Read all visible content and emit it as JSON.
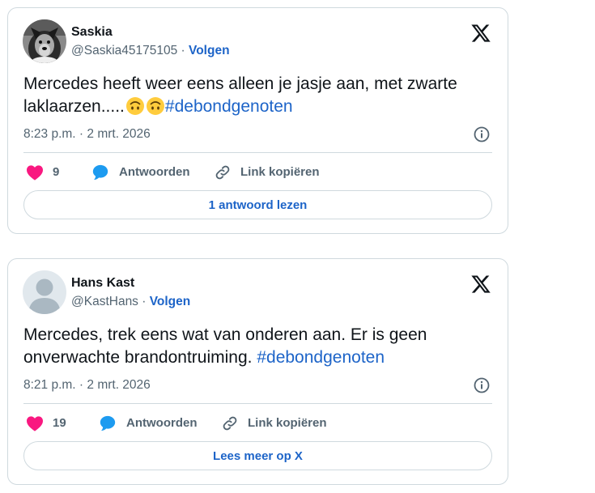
{
  "tweets": [
    {
      "author": "Saskia",
      "handle": "@Saskia45175105",
      "separator": "·",
      "follow_label": "Volgen",
      "text": "Mercedes heeft weer eens alleen je jasje aan, met zwarte laklaarzen.....",
      "emojis": [
        "upside-down-face-emoji",
        "upside-down-face-emoji"
      ],
      "hashtag": "#debondgenoten",
      "timestamp": "8:23 p.m. · 2 mrt. 2026",
      "likes": "9",
      "reply_label": "Antwoorden",
      "copy_link_label": "Link kopiëren",
      "button_label": "1 antwoord lezen",
      "avatar": "dog-photo"
    },
    {
      "author": "Hans Kast",
      "handle": "@KastHans",
      "separator": "·",
      "follow_label": "Volgen",
      "text": "Mercedes, trek eens wat van onderen aan. Er is geen onverwachte brandontruiming.",
      "hashtag": "#debondgenoten",
      "timestamp": "8:21 p.m. · 2 mrt. 2026",
      "likes": "19",
      "reply_label": "Antwoorden",
      "copy_link_label": "Link kopiëren",
      "button_label": "Lees meer op X",
      "avatar": "default-avatar"
    }
  ],
  "colors": {
    "link_blue": "#1d64c8",
    "heart_pink": "#f91880",
    "reply_blue": "#1d9bf0",
    "secondary_text": "#536471",
    "border": "#cfd9de"
  },
  "icons": [
    "x-logo-icon",
    "info-icon",
    "heart-icon",
    "reply-bubble-icon",
    "link-icon"
  ]
}
